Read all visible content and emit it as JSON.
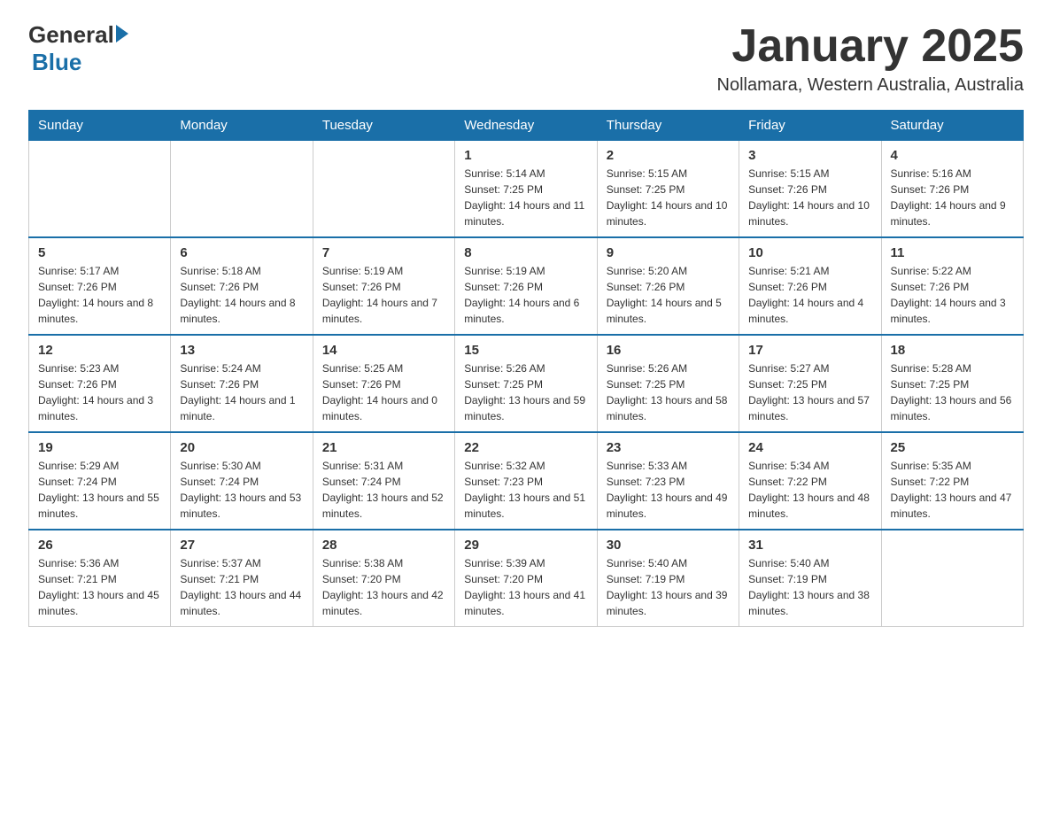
{
  "header": {
    "title": "January 2025",
    "subtitle": "Nollamara, Western Australia, Australia",
    "logo_general": "General",
    "logo_blue": "Blue"
  },
  "columns": [
    "Sunday",
    "Monday",
    "Tuesday",
    "Wednesday",
    "Thursday",
    "Friday",
    "Saturday"
  ],
  "weeks": [
    [
      {
        "day": "",
        "info": ""
      },
      {
        "day": "",
        "info": ""
      },
      {
        "day": "",
        "info": ""
      },
      {
        "day": "1",
        "info": "Sunrise: 5:14 AM\nSunset: 7:25 PM\nDaylight: 14 hours and 11 minutes."
      },
      {
        "day": "2",
        "info": "Sunrise: 5:15 AM\nSunset: 7:25 PM\nDaylight: 14 hours and 10 minutes."
      },
      {
        "day": "3",
        "info": "Sunrise: 5:15 AM\nSunset: 7:26 PM\nDaylight: 14 hours and 10 minutes."
      },
      {
        "day": "4",
        "info": "Sunrise: 5:16 AM\nSunset: 7:26 PM\nDaylight: 14 hours and 9 minutes."
      }
    ],
    [
      {
        "day": "5",
        "info": "Sunrise: 5:17 AM\nSunset: 7:26 PM\nDaylight: 14 hours and 8 minutes."
      },
      {
        "day": "6",
        "info": "Sunrise: 5:18 AM\nSunset: 7:26 PM\nDaylight: 14 hours and 8 minutes."
      },
      {
        "day": "7",
        "info": "Sunrise: 5:19 AM\nSunset: 7:26 PM\nDaylight: 14 hours and 7 minutes."
      },
      {
        "day": "8",
        "info": "Sunrise: 5:19 AM\nSunset: 7:26 PM\nDaylight: 14 hours and 6 minutes."
      },
      {
        "day": "9",
        "info": "Sunrise: 5:20 AM\nSunset: 7:26 PM\nDaylight: 14 hours and 5 minutes."
      },
      {
        "day": "10",
        "info": "Sunrise: 5:21 AM\nSunset: 7:26 PM\nDaylight: 14 hours and 4 minutes."
      },
      {
        "day": "11",
        "info": "Sunrise: 5:22 AM\nSunset: 7:26 PM\nDaylight: 14 hours and 3 minutes."
      }
    ],
    [
      {
        "day": "12",
        "info": "Sunrise: 5:23 AM\nSunset: 7:26 PM\nDaylight: 14 hours and 3 minutes."
      },
      {
        "day": "13",
        "info": "Sunrise: 5:24 AM\nSunset: 7:26 PM\nDaylight: 14 hours and 1 minute."
      },
      {
        "day": "14",
        "info": "Sunrise: 5:25 AM\nSunset: 7:26 PM\nDaylight: 14 hours and 0 minutes."
      },
      {
        "day": "15",
        "info": "Sunrise: 5:26 AM\nSunset: 7:25 PM\nDaylight: 13 hours and 59 minutes."
      },
      {
        "day": "16",
        "info": "Sunrise: 5:26 AM\nSunset: 7:25 PM\nDaylight: 13 hours and 58 minutes."
      },
      {
        "day": "17",
        "info": "Sunrise: 5:27 AM\nSunset: 7:25 PM\nDaylight: 13 hours and 57 minutes."
      },
      {
        "day": "18",
        "info": "Sunrise: 5:28 AM\nSunset: 7:25 PM\nDaylight: 13 hours and 56 minutes."
      }
    ],
    [
      {
        "day": "19",
        "info": "Sunrise: 5:29 AM\nSunset: 7:24 PM\nDaylight: 13 hours and 55 minutes."
      },
      {
        "day": "20",
        "info": "Sunrise: 5:30 AM\nSunset: 7:24 PM\nDaylight: 13 hours and 53 minutes."
      },
      {
        "day": "21",
        "info": "Sunrise: 5:31 AM\nSunset: 7:24 PM\nDaylight: 13 hours and 52 minutes."
      },
      {
        "day": "22",
        "info": "Sunrise: 5:32 AM\nSunset: 7:23 PM\nDaylight: 13 hours and 51 minutes."
      },
      {
        "day": "23",
        "info": "Sunrise: 5:33 AM\nSunset: 7:23 PM\nDaylight: 13 hours and 49 minutes."
      },
      {
        "day": "24",
        "info": "Sunrise: 5:34 AM\nSunset: 7:22 PM\nDaylight: 13 hours and 48 minutes."
      },
      {
        "day": "25",
        "info": "Sunrise: 5:35 AM\nSunset: 7:22 PM\nDaylight: 13 hours and 47 minutes."
      }
    ],
    [
      {
        "day": "26",
        "info": "Sunrise: 5:36 AM\nSunset: 7:21 PM\nDaylight: 13 hours and 45 minutes."
      },
      {
        "day": "27",
        "info": "Sunrise: 5:37 AM\nSunset: 7:21 PM\nDaylight: 13 hours and 44 minutes."
      },
      {
        "day": "28",
        "info": "Sunrise: 5:38 AM\nSunset: 7:20 PM\nDaylight: 13 hours and 42 minutes."
      },
      {
        "day": "29",
        "info": "Sunrise: 5:39 AM\nSunset: 7:20 PM\nDaylight: 13 hours and 41 minutes."
      },
      {
        "day": "30",
        "info": "Sunrise: 5:40 AM\nSunset: 7:19 PM\nDaylight: 13 hours and 39 minutes."
      },
      {
        "day": "31",
        "info": "Sunrise: 5:40 AM\nSunset: 7:19 PM\nDaylight: 13 hours and 38 minutes."
      },
      {
        "day": "",
        "info": ""
      }
    ]
  ]
}
